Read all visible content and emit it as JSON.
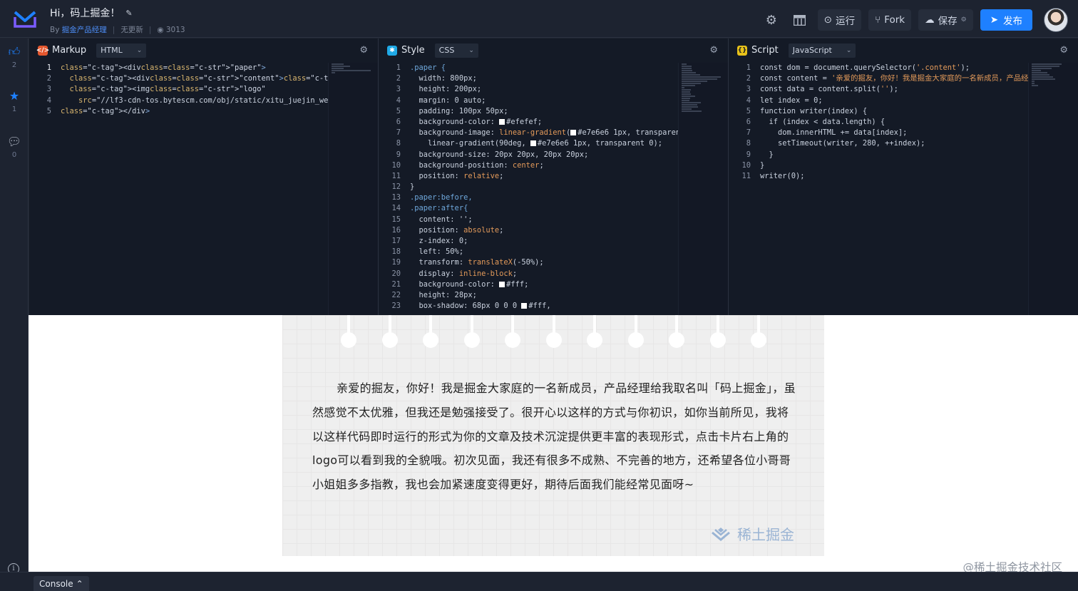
{
  "header": {
    "title": "Hi，码上掘金！",
    "by_label": "By",
    "author": "掘金产品经理",
    "update_status": "无更新",
    "views": "3013",
    "run_label": "运行",
    "fork_label": "Fork",
    "save_label": "保存",
    "publish_label": "发布"
  },
  "rail": {
    "like_count": "2",
    "star_count": "1",
    "comment_count": "0"
  },
  "panes": {
    "markup": {
      "title": "Markup",
      "lang": "HTML"
    },
    "style": {
      "title": "Style",
      "lang": "CSS"
    },
    "script": {
      "title": "Script",
      "lang": "JavaScript"
    }
  },
  "code": {
    "markup": [
      "<div class=\"paper\">",
      "  <div class=\"content\"></div>",
      "  <img class=\"logo\"",
      "    src=\"//lf3-cdn-tos.bytescm.com/obj/static/xitu_juejin_web",
      "</div>"
    ],
    "style": [
      ".paper {",
      "  width: 800px;",
      "  height: 200px;",
      "  margin: 0 auto;",
      "  padding: 100px 50px;",
      "  background-color: ■#efefef;",
      "  background-image: linear-gradient(■#e7e6e6 1px, transparent",
      "    linear-gradient(90deg, ■#e7e6e6 1px, transparent 0);",
      "  background-size: 20px 20px, 20px 20px;",
      "  background-position: center;",
      "  position: relative;",
      "}",
      ".paper:before,",
      ".paper:after{",
      "  content: '';",
      "  position: absolute;",
      "  z-index: 0;",
      "  left: 50%;",
      "  transform: translateX(-50%);",
      "  display: inline-block;",
      "  background-color: ■#fff;",
      "  height: 28px;",
      "  box-shadow: 68px 0 0 0 ■#fff,"
    ],
    "script": [
      "const dom = document.querySelector('.content');",
      "const content = '亲爱的掘友，你好！我是掘金大家庭的一名新成员，产品经",
      "const data = content.split('');",
      "let index = 0;",
      "function writer(index) {",
      "  if (index < data.length) {",
      "    dom.innerHTML += data[index];",
      "    setTimeout(writer, 280, ++index);",
      "  }",
      "}",
      "writer(0);"
    ]
  },
  "preview": {
    "text": "亲爱的掘友，你好！我是掘金大家庭的一名新成员，产品经理给我取名叫「码上掘金」，虽然感觉不太优雅，但我还是勉强接受了。很开心以这样的方式与你初识，如你当前所见，我将以这样代码即时运行的形式为你的文章及技术沉淀提供更丰富的表现形式，点击卡片右上角的logo可以看到我的全貌哦。初次见面，我还有很多不成熟、不完善的地方，还希望各位小哥哥小姐姐多多指教，我也会加紧速度变得更好，期待后面我们能经常见面呀~",
    "logo_text": "稀土掘金",
    "watermark": "@稀土掘金技术社区"
  },
  "bottom": {
    "console_label": "Console"
  },
  "colors": {
    "accent": "#1e80ff",
    "bg": "#1f2430",
    "editor_bg": "#141a26",
    "paper": "#efefef"
  }
}
